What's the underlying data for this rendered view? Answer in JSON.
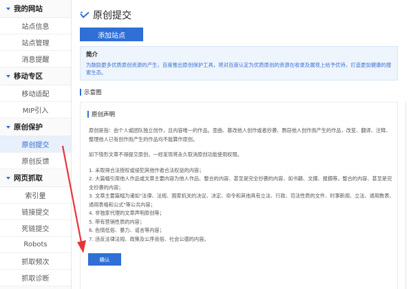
{
  "sidebar": {
    "sections": [
      {
        "title": "我的网站",
        "items": [
          "站点信息",
          "站点管理",
          "消息提醒"
        ]
      },
      {
        "title": "移动专区",
        "items": [
          "移动适配",
          "MIP引入"
        ]
      },
      {
        "title": "原创保护",
        "items": [
          "原创提交",
          "原创反馈"
        ]
      },
      {
        "title": "网页抓取",
        "items": [
          "索引量",
          "链接提交",
          "死链提交",
          "Robots",
          "抓取频次",
          "抓取诊断"
        ]
      }
    ],
    "active_item": "原创提交"
  },
  "main": {
    "title": "原创提交",
    "add_site_label": "添加站点",
    "intro": {
      "heading": "简介",
      "text": "为鼓励更多优质原创资源的产生，百度推出原创保护工具，将对百度认定为优质原创的资源在收录及展现上给予优待，打造更加健康的搜索生态。"
    },
    "diagram_heading": "示意图",
    "declaration": {
      "heading": "原创声明",
      "paragraphs": [
        "原创是指：由个人或团队独立创作，且内容唯一的作品。歪曲、篡改他人创作或者抄袭、剽窃他人创作而产生的作品，改变、翻译、注释、整理他人已有创作而产生的作品均不能算作原创。",
        "如下情形文章不得提交原创，一经发现将永久取消原创功能使用权限。",
        "1. 未取得合法授权或侵犯其他作者合法权益的内容；",
        "2. 大篇幅引用他人作品或文章主要内容为他人作品、整合的内容、甚至是完全抄袭的内容，如书籍、文摘、报摘等，整合的内容、甚至是完全抄袭的内容；",
        "3. 文章主要篇幅为诸如\"法律、法规、国家机关的决议、决定、命令和其他具有立法、行政、司法性质的文件、时事新闻、立法、通用数表、通用表格和公式\"等公共内容；",
        "4. 非独家代理的文章声明原创等；",
        "5. 带有营销性质的内容；",
        "6. 色情低俗、暴力、谣言等内容；",
        "7. 违反法律法规、政策及公序良俗、社会公德的内容。"
      ],
      "confirm_label": "确认"
    }
  },
  "colors": {
    "accent": "#2f6fd6",
    "annotation_arrow": "#e8343a",
    "intro_bg": "#eef5fc"
  }
}
